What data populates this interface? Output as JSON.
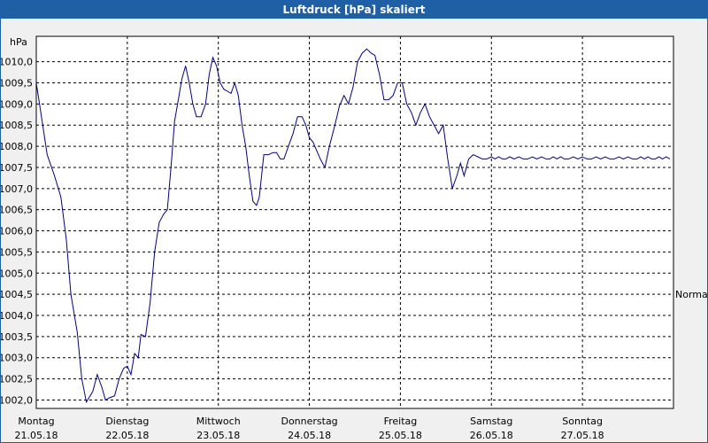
{
  "title": "Luftdruck [hPa] skaliert",
  "chart_data": {
    "type": "line",
    "title": "Luftdruck [hPa] skaliert",
    "ylabel": "hPa",
    "ylim": [
      1001.8,
      1010.6
    ],
    "yticks": [
      "1010,0",
      "1009,5",
      "1009,0",
      "1008,5",
      "1008,0",
      "1007,5",
      "1007,0",
      "1006,5",
      "1006,0",
      "1005,5",
      "1005,0",
      "1004,5",
      "1004,0",
      "1003,5",
      "1003,0",
      "1002,5",
      "1002,0"
    ],
    "ytick_values": [
      1010.0,
      1009.5,
      1009.0,
      1008.5,
      1008.0,
      1007.5,
      1007.0,
      1006.5,
      1006.0,
      1005.5,
      1005.0,
      1004.5,
      1004.0,
      1003.5,
      1003.0,
      1002.5,
      1002.0
    ],
    "xlim": [
      0,
      7.0
    ],
    "xticks": [
      {
        "day": "Montag",
        "date": "21.05.18",
        "x": 0
      },
      {
        "day": "Dienstag",
        "date": "22.05.18",
        "x": 1
      },
      {
        "day": "Mittwoch",
        "date": "23.05.18",
        "x": 2
      },
      {
        "day": "Donnerstag",
        "date": "24.05.18",
        "x": 3
      },
      {
        "day": "Freitag",
        "date": "25.05.18",
        "x": 4
      },
      {
        "day": "Samstag",
        "date": "26.05.18",
        "x": 5
      },
      {
        "day": "Sonntag",
        "date": "27.05.18",
        "x": 6
      }
    ],
    "reference_label": "Normal",
    "reference_value": 1004.5,
    "grid": true,
    "line_color": "#000080",
    "series": [
      {
        "x": [
          0.0,
          0.05,
          0.12,
          0.2,
          0.27,
          0.33,
          0.38,
          0.45,
          0.5,
          0.55,
          0.62,
          0.67,
          0.72,
          0.76,
          0.8,
          0.86,
          0.91,
          0.96,
          1.0,
          1.04,
          1.08,
          1.12,
          1.15,
          1.2,
          1.25,
          1.3,
          1.35,
          1.4,
          1.44,
          1.48,
          1.52,
          1.56,
          1.6,
          1.64,
          1.68,
          1.72,
          1.76,
          1.81,
          1.86,
          1.9,
          1.94,
          1.98,
          2.02,
          2.06,
          2.1,
          2.14,
          2.18,
          2.22,
          2.26,
          2.3,
          2.34,
          2.38,
          2.42,
          2.45,
          2.5,
          2.55,
          2.6,
          2.64,
          2.68,
          2.72,
          2.77,
          2.82,
          2.87,
          2.92,
          2.96,
          3.0,
          3.04,
          3.08,
          3.12,
          3.17,
          3.22,
          3.28,
          3.33,
          3.38,
          3.43,
          3.48,
          3.53,
          3.58,
          3.63,
          3.68,
          3.72,
          3.77,
          3.82,
          3.87,
          3.92,
          3.97,
          4.02,
          4.07,
          4.12,
          4.17,
          4.22,
          4.27,
          4.32,
          4.37,
          4.42,
          4.47,
          4.52,
          4.57,
          4.62,
          4.66,
          4.7,
          4.75,
          4.8,
          4.85,
          4.9,
          4.95,
          5.0,
          5.04,
          5.08,
          5.12,
          5.16,
          5.2,
          5.25,
          5.3,
          5.35,
          5.4,
          5.45,
          5.5,
          5.55,
          5.6,
          5.64,
          5.68,
          5.72,
          5.76,
          5.8,
          5.85,
          5.9,
          5.95,
          6.0,
          6.05,
          6.1,
          6.15,
          6.2,
          6.25,
          6.3,
          6.35,
          6.4,
          6.45,
          6.5,
          6.55,
          6.6,
          6.64,
          6.68,
          6.72,
          6.76,
          6.8,
          6.84,
          6.88,
          6.92,
          6.96
        ],
        "y": [
          1009.5,
          1008.8,
          1007.8,
          1007.3,
          1006.8,
          1005.8,
          1004.5,
          1003.6,
          1002.5,
          1001.95,
          1002.2,
          1002.6,
          1002.3,
          1002.0,
          1002.05,
          1002.1,
          1002.5,
          1002.75,
          1002.8,
          1002.6,
          1003.1,
          1003.0,
          1003.55,
          1003.5,
          1004.3,
          1005.5,
          1006.2,
          1006.4,
          1006.5,
          1007.5,
          1008.6,
          1009.1,
          1009.6,
          1009.9,
          1009.5,
          1009.0,
          1008.7,
          1008.7,
          1009.0,
          1009.7,
          1010.1,
          1009.9,
          1009.5,
          1009.35,
          1009.3,
          1009.25,
          1009.5,
          1009.2,
          1008.5,
          1008.0,
          1007.3,
          1006.7,
          1006.6,
          1006.8,
          1007.8,
          1007.8,
          1007.85,
          1007.85,
          1007.7,
          1007.7,
          1008.0,
          1008.3,
          1008.7,
          1008.7,
          1008.5,
          1008.2,
          1008.1,
          1007.9,
          1007.7,
          1007.5,
          1008.0,
          1008.5,
          1008.95,
          1009.2,
          1009.0,
          1009.4,
          1010.0,
          1010.2,
          1010.3,
          1010.2,
          1010.15,
          1009.7,
          1009.1,
          1009.1,
          1009.2,
          1009.5,
          1009.5,
          1009.0,
          1008.8,
          1008.5,
          1008.8,
          1009.0,
          1008.7,
          1008.5,
          1008.3,
          1008.5,
          1007.7,
          1007.0,
          1007.3,
          1007.6,
          1007.3,
          1007.7,
          1007.8,
          1007.75,
          1007.7,
          1007.7,
          1007.75,
          1007.7,
          1007.75,
          1007.7,
          1007.7,
          1007.75,
          1007.7,
          1007.75,
          1007.7,
          1007.7,
          1007.75,
          1007.7,
          1007.75,
          1007.7,
          1007.7,
          1007.75,
          1007.7,
          1007.75,
          1007.7,
          1007.7,
          1007.75,
          1007.7,
          1007.75,
          1007.7,
          1007.7,
          1007.75,
          1007.7,
          1007.75,
          1007.7,
          1007.7,
          1007.75,
          1007.7,
          1007.75,
          1007.7,
          1007.7,
          1007.75,
          1007.7,
          1007.75,
          1007.7,
          1007.7,
          1007.75,
          1007.7,
          1007.75,
          1007.7
        ]
      }
    ]
  }
}
